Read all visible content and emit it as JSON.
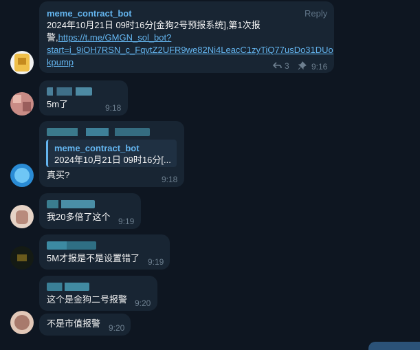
{
  "messages": {
    "m1": {
      "sender": "meme_contract_bot",
      "reply_label": "Reply",
      "line1": "2024年10月21日 09时16分[金狗2号预报系统],第1次报",
      "line2_prefix": "警,",
      "link_part1": "https://t.me/GMGN_sol_bot?",
      "link_part2": "start=i_9iOH7RSN_c_FqvtZ2UFR9we82Ni4LeacC1zyTiQ77usDo31DUo",
      "link_part3": "kpump",
      "reply_count": "3",
      "time": "9:16"
    },
    "m2": {
      "text": "5m了",
      "time": "9:18"
    },
    "m3": {
      "quote_sender": "meme_contract_bot",
      "quote_text": "2024年10月21日 09时16分[...",
      "text": "真买?",
      "time": "9:18"
    },
    "m4": {
      "text": "我20多倍了这个",
      "time": "9:19"
    },
    "m5": {
      "text": "5M才报是不是设置错了",
      "time": "9:19"
    },
    "m6": {
      "text": "这个是金狗二号报警",
      "time": "9:20"
    },
    "m7": {
      "text": "不是市值报警",
      "time": "9:20"
    }
  },
  "colors": {
    "background": "#0e1621",
    "bubble": "#182533",
    "accent": "#64b5ef",
    "muted": "#6d7f8f"
  }
}
